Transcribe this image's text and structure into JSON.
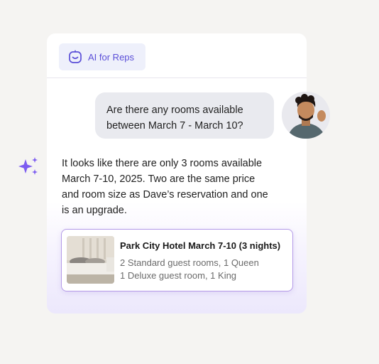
{
  "brand": {
    "label": "AI for Reps",
    "icon": "smile-bot-icon",
    "accent": "#5b4fd8"
  },
  "conversation": {
    "user_message_lines": [
      "Are there any rooms available",
      "between March 7 - March 10?"
    ],
    "ai_message_lines": [
      "It looks like there are only 3 rooms available",
      "March 7-10, 2025. Two are the same price",
      "and room size as Dave’s reservation and one",
      "is an upgrade."
    ]
  },
  "hotel_card": {
    "title": "Park City Hotel March 7-10 (3 nights)",
    "lines": [
      "2 Standard guest rooms, 1 Queen",
      "1 Deluxe guest room, 1 King"
    ],
    "thumbnail": "hotel-bedroom-image",
    "border_color": "#b49ae8"
  },
  "decor": {
    "sparkle_icon": "sparkle-icon",
    "sparkle_color": "#7c5cf0"
  }
}
